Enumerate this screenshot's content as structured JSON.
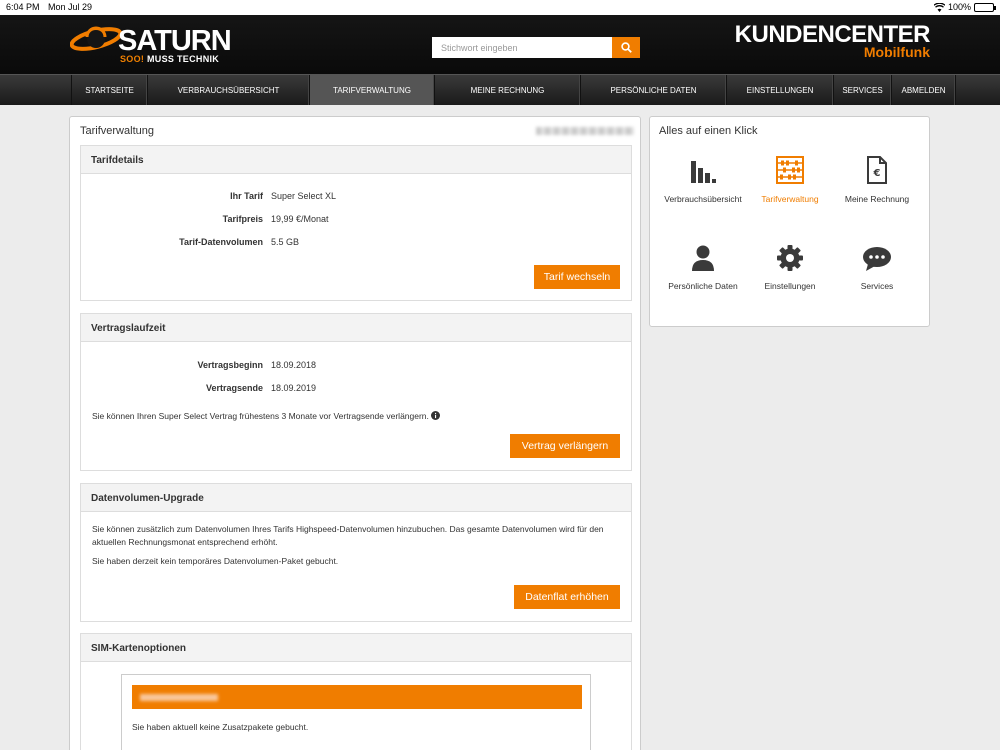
{
  "status_bar": {
    "time": "6:04 PM",
    "date": "Mon Jul 29",
    "battery": "100%"
  },
  "header": {
    "logo_text": "SATURN",
    "logo_tag_prefix": "SOO!",
    "logo_tag_rest": " MUSS TECHNIK",
    "search_placeholder": "Stichwort eingeben",
    "brand_line1": "KUNDENCENTER",
    "brand_line2": "Mobilfunk"
  },
  "nav": {
    "items": [
      {
        "label": "STARTSEITE"
      },
      {
        "label": "VERBRAUCHSÜBERSICHT"
      },
      {
        "label": "TARIFVERWALTUNG",
        "active": true
      },
      {
        "label": "MEINE RECHNUNG"
      },
      {
        "label": "PERSÖNLICHE DATEN"
      },
      {
        "label": "EINSTELLUNGEN"
      },
      {
        "label": "SERVICES"
      },
      {
        "label": "ABMELDEN"
      }
    ]
  },
  "main": {
    "title": "Tarifverwaltung",
    "tarifdetails": {
      "header": "Tarifdetails",
      "rows": [
        {
          "label": "Ihr Tarif",
          "value": "Super Select XL"
        },
        {
          "label": "Tarifpreis",
          "value": "19,99 €/Monat"
        },
        {
          "label": "Tarif-Datenvolumen",
          "value": "5.5 GB"
        }
      ],
      "button": "Tarif wechseln"
    },
    "vertragslaufzeit": {
      "header": "Vertragslaufzeit",
      "rows": [
        {
          "label": "Vertragsbeginn",
          "value": "18.09.2018"
        },
        {
          "label": "Vertragsende",
          "value": "18.09.2019"
        }
      ],
      "note": "Sie können Ihren Super Select Vertrag frühestens 3 Monate vor Vertragsende verlängern.",
      "button": "Vertrag verlängern"
    },
    "datenvolumen": {
      "header": "Datenvolumen-Upgrade",
      "text1": "Sie können zusätzlich zum Datenvolumen Ihres Tarifs Highspeed-Datenvolumen hinzubuchen. Das gesamte Datenvolumen wird für den aktuellen Rechnungsmonat entsprechend erhöht.",
      "text2": "Sie haben derzeit kein temporäres Datenvolumen-Paket gebucht.",
      "button": "Datenflat erhöhen"
    },
    "sim": {
      "header": "SIM-Kartenoptionen",
      "text": "Sie haben aktuell keine Zusatzpakete gebucht."
    }
  },
  "sidebar": {
    "title": "Alles auf einen Klick",
    "tiles": [
      {
        "label": "Verbrauchsübersicht",
        "icon": "bar-chart-icon"
      },
      {
        "label": "Tarifverwaltung",
        "icon": "abacus-icon",
        "active": true
      },
      {
        "label": "Meine Rechnung",
        "icon": "invoice-icon"
      },
      {
        "label": "Persönliche Daten",
        "icon": "person-icon"
      },
      {
        "label": "Einstellungen",
        "icon": "gear-icon"
      },
      {
        "label": "Services",
        "icon": "chat-icon"
      }
    ]
  },
  "colors": {
    "accent": "#f07d00",
    "header_bg": "#111111",
    "nav_active": "#555555"
  }
}
